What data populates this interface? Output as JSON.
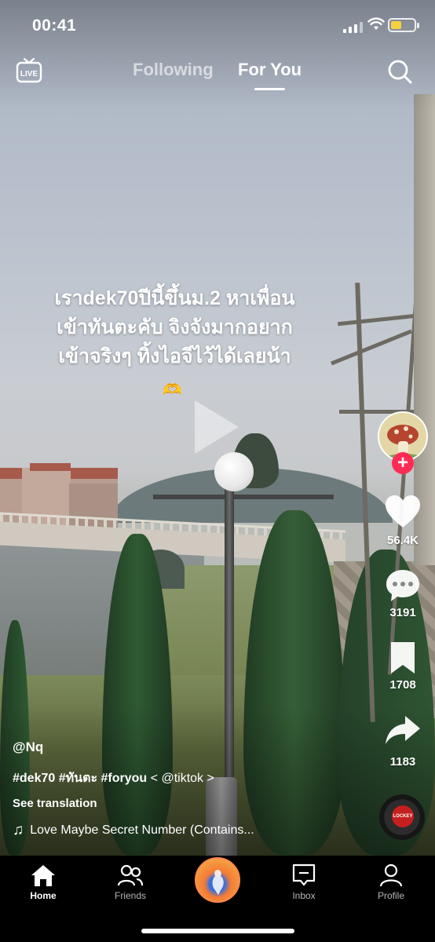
{
  "status_bar": {
    "time": "00:41",
    "battery_level": 0.45
  },
  "top_nav": {
    "live_label": "LIVE",
    "tabs": [
      {
        "label": "Following",
        "active": false
      },
      {
        "label": "For You",
        "active": true
      }
    ]
  },
  "video": {
    "overlay_text_lines": [
      "เราdek70ปีนี้ขึ้นม.2 หาเพื่อน",
      "เข้าทันตะคับ จิงจังมากอยาก",
      "เข้าจริงๆ ทิ้งไอจีไว้ได้เลยน้า"
    ],
    "overlay_emoji": "🫶"
  },
  "right_rail": {
    "likes": "56.4K",
    "comments": "3191",
    "saves": "1708",
    "shares": "1183",
    "disc_label": "LOCKEY"
  },
  "post": {
    "username": "@Nq",
    "hashtags": "#dek70 #ทันตะ #foryou",
    "mention": "< @tiktok >",
    "see_translation": "See translation",
    "music": "Love Maybe Secret Number (Contains..."
  },
  "bottom_nav": {
    "home": "Home",
    "friends": "Friends",
    "inbox": "Inbox",
    "profile": "Profile"
  },
  "colors": {
    "accent": "#fe2c55",
    "battery": "#f5d142",
    "background": "#000000"
  }
}
